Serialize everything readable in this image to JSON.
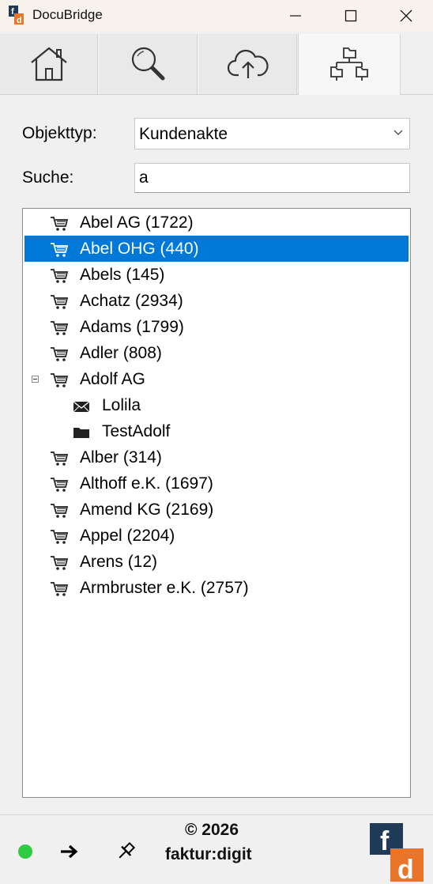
{
  "window": {
    "title": "DocuBridge"
  },
  "tabs": [
    {
      "name": "home-tab",
      "icon": "home-icon"
    },
    {
      "name": "search-tab",
      "icon": "magnifier-icon"
    },
    {
      "name": "upload-tab",
      "icon": "cloud-upload-icon"
    },
    {
      "name": "structure-tab",
      "icon": "folder-tree-icon",
      "active": true
    }
  ],
  "form": {
    "objekttyp_label": "Objekttyp:",
    "objekttyp_value": "Kundenakte",
    "suche_label": "Suche:",
    "suche_value": "a"
  },
  "tree": [
    {
      "label": "Abel AG (1722)",
      "icon": "cart-icon",
      "level": 0
    },
    {
      "label": "Abel OHG (440)",
      "icon": "cart-icon",
      "level": 0,
      "selected": true
    },
    {
      "label": "Abels (145)",
      "icon": "cart-icon",
      "level": 0
    },
    {
      "label": "Achatz (2934)",
      "icon": "cart-icon",
      "level": 0
    },
    {
      "label": "Adams (1799)",
      "icon": "cart-icon",
      "level": 0
    },
    {
      "label": "Adler (808)",
      "icon": "cart-icon",
      "level": 0
    },
    {
      "label": "Adolf AG",
      "icon": "cart-icon",
      "level": 0,
      "expanded": true
    },
    {
      "label": "Lolila",
      "icon": "envelope-icon",
      "level": 1
    },
    {
      "label": "TestAdolf",
      "icon": "folder-icon",
      "level": 1
    },
    {
      "label": "Alber (314)",
      "icon": "cart-icon",
      "level": 0
    },
    {
      "label": "Althoff e.K. (1697)",
      "icon": "cart-icon",
      "level": 0
    },
    {
      "label": "Amend KG (2169)",
      "icon": "cart-icon",
      "level": 0
    },
    {
      "label": "Appel (2204)",
      "icon": "cart-icon",
      "level": 0
    },
    {
      "label": "Arens (12)",
      "icon": "cart-icon",
      "level": 0
    },
    {
      "label": "Armbruster e.K. (2757)",
      "icon": "cart-icon",
      "level": 0
    }
  ],
  "footer": {
    "copyright": "© 2026",
    "company": "faktur:digit",
    "status_color": "#2ecc40"
  },
  "colors": {
    "selection": "#0078d7",
    "logo_navy": "#1f3b57",
    "logo_orange": "#e8752a"
  }
}
